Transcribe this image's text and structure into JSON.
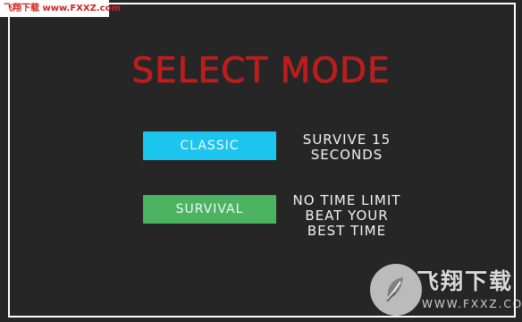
{
  "watermark": {
    "top_text": "飞翔下载 www.FXXZ.com",
    "bottom_logo_text": "飞翔下载",
    "bottom_logo_url": "WWW.FXXZ.COM"
  },
  "screen": {
    "title": "SELECT MODE"
  },
  "modes": [
    {
      "label": "CLASSIC",
      "description_lines": [
        "SURVIVE 15",
        "SECONDS"
      ],
      "color": "#1bc5ee"
    },
    {
      "label": "SURVIVAL",
      "description_lines": [
        "NO TIME LIMIT",
        "BEAT YOUR",
        "BEST TIME"
      ],
      "color": "#4cb361"
    }
  ],
  "colors": {
    "background": "#262626",
    "frame": "#ffffff",
    "title": "#c51919"
  },
  "icons": {
    "watermark_logo": "feather-logo-icon"
  }
}
